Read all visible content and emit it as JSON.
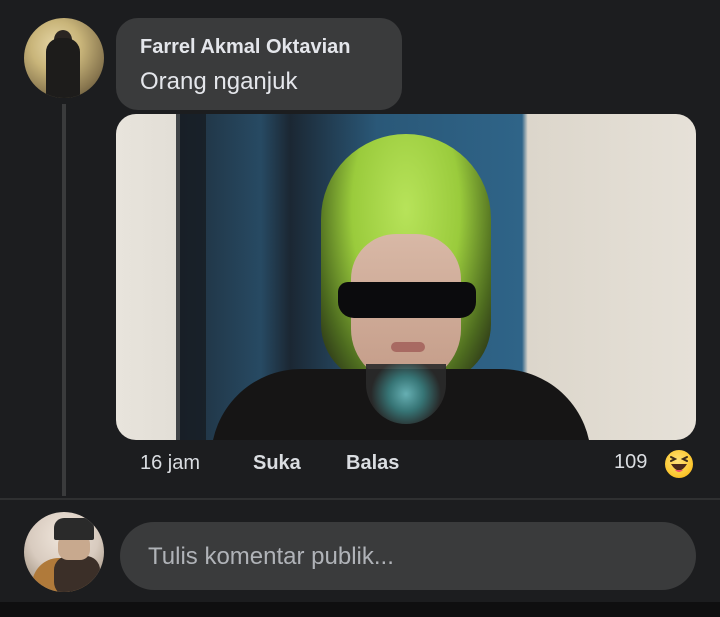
{
  "comment": {
    "author": "Farrel Akmal Oktavian",
    "text": "Orang nganjuk",
    "time": "16 jam",
    "like_label": "Suka",
    "reply_label": "Balas",
    "reaction_count": "109",
    "reaction_icon": "haha-emoji"
  },
  "composer": {
    "placeholder": "Tulis komentar publik..."
  },
  "colors": {
    "background": "#1c1d1f",
    "bubble": "#3a3b3c",
    "text_primary": "#e4e6eb",
    "text_secondary": "#b0b3b8",
    "reaction_yellow": "#fcc934"
  }
}
